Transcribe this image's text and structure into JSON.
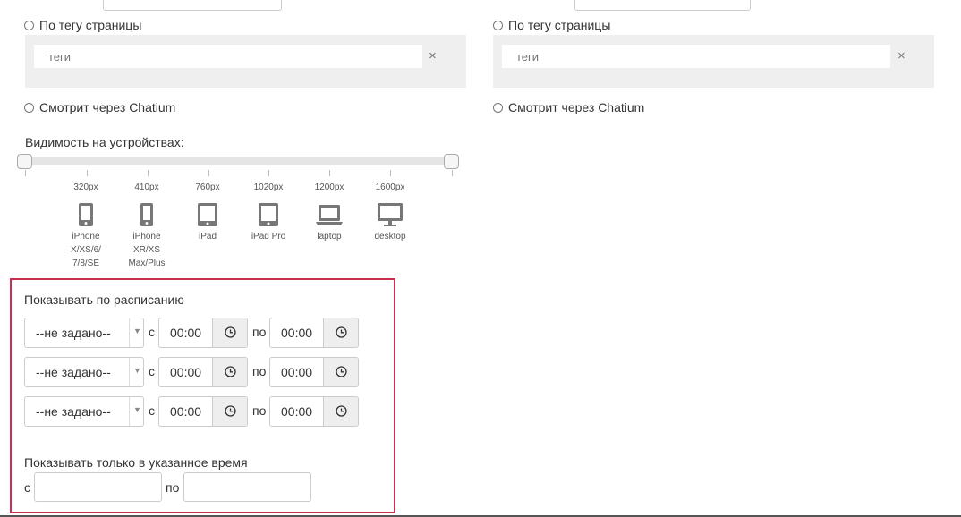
{
  "left": {
    "radio_page_tag": "По тегу страницы",
    "tags_placeholder": "теги",
    "radio_chatium": "Смотрит через Chatium"
  },
  "right": {
    "radio_page_tag": "По тегу страницы",
    "tags_placeholder": "теги",
    "radio_chatium": "Смотрит через Chatium"
  },
  "clear_glyph": "×",
  "devices": {
    "title": "Видимость на устройствах:",
    "slider_range": [
      0,
      1
    ],
    "items": [
      {
        "px": "320px",
        "name": "iPhone X/XS/6/ 7/8/SE",
        "icon": "phone-icon"
      },
      {
        "px": "410px",
        "name": "iPhone XR/XS Max/Plus",
        "icon": "phone-icon"
      },
      {
        "px": "760px",
        "name": "iPad",
        "icon": "tablet-icon"
      },
      {
        "px": "1020px",
        "name": "iPad Pro",
        "icon": "tablet-icon"
      },
      {
        "px": "1200px",
        "name": "laptop",
        "icon": "laptop-icon"
      },
      {
        "px": "1600px",
        "name": "desktop",
        "icon": "desktop-icon"
      }
    ]
  },
  "schedule": {
    "title": "Показывать по расписанию",
    "from_label": "с",
    "to_label": "по",
    "rows": [
      {
        "day": "--не задано--",
        "from": "00:00",
        "to": "00:00"
      },
      {
        "day": "--не задано--",
        "from": "00:00",
        "to": "00:00"
      },
      {
        "day": "--не задано--",
        "from": "00:00",
        "to": "00:00"
      }
    ],
    "only_title": "Показывать только в указанное время",
    "only_from_label": "с",
    "only_to_label": "по"
  },
  "colors": {
    "accent_border": "#c9304f",
    "icon_gray": "#777777"
  }
}
